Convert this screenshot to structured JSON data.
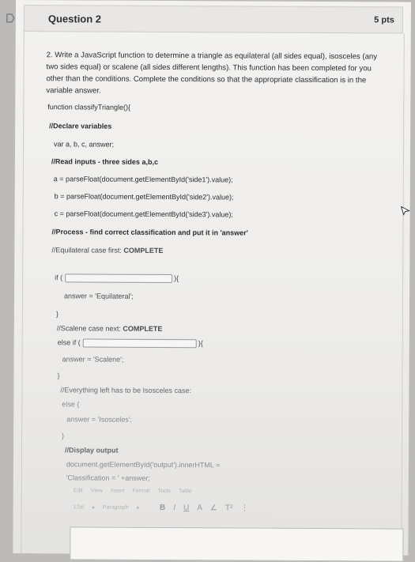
{
  "question": {
    "title": "Question 2",
    "points": "5 pts",
    "intro": "2. Write a JavaScript function to determine a triangle as equilateral (all sides equal), isosceles (any two sides equal) or scalene (all sides different lengths). This function has been completed for you other than the conditions. Complete the conditions so that the appropriate classification is in the variable answer."
  },
  "code": {
    "l1": "function classifyTriangle(){",
    "l2": "//Declare variables",
    "l3": "var a, b, c, answer;",
    "l4": "//Read inputs - three sides a,b,c",
    "l5": "a = parseFloat(document.getElementById('side1').value);",
    "l6": "b = parseFloat(document.getElementById('side2').value);",
    "l7": "c = parseFloat(document.getElementById('side3').value);",
    "l8": "//Process - find correct classification and put it in 'answer'",
    "l9a": "//Equilateral case first: ",
    "l9b": "COMPLETE",
    "l10a": "if (",
    "l10b": "){",
    "l11": "answer = 'Equilateral';",
    "l12": "}",
    "l13a": "//Scalene case next: ",
    "l13b": "COMPLETE",
    "l14a": "else if (",
    "l14b": "){",
    "l15": "answer = 'Scalene';",
    "l16": "}",
    "l17": "//Everything left has to be Isosceles case:",
    "l18": "else {",
    "l19": "answer = 'Isosceles';",
    "l20": "}",
    "l21": "//Display output",
    "l22": "document.getElementById('output').innerHTML =",
    "l23": "'Classification = ' +answer;"
  },
  "editor": {
    "menu": [
      "Edit",
      "View",
      "Insert",
      "Format",
      "Tools",
      "Table"
    ],
    "font_size": "12pt",
    "paragraph": "Paragraph",
    "buttons": [
      "B",
      "I",
      "U",
      "A",
      "∠",
      "T²",
      "⋮"
    ]
  }
}
